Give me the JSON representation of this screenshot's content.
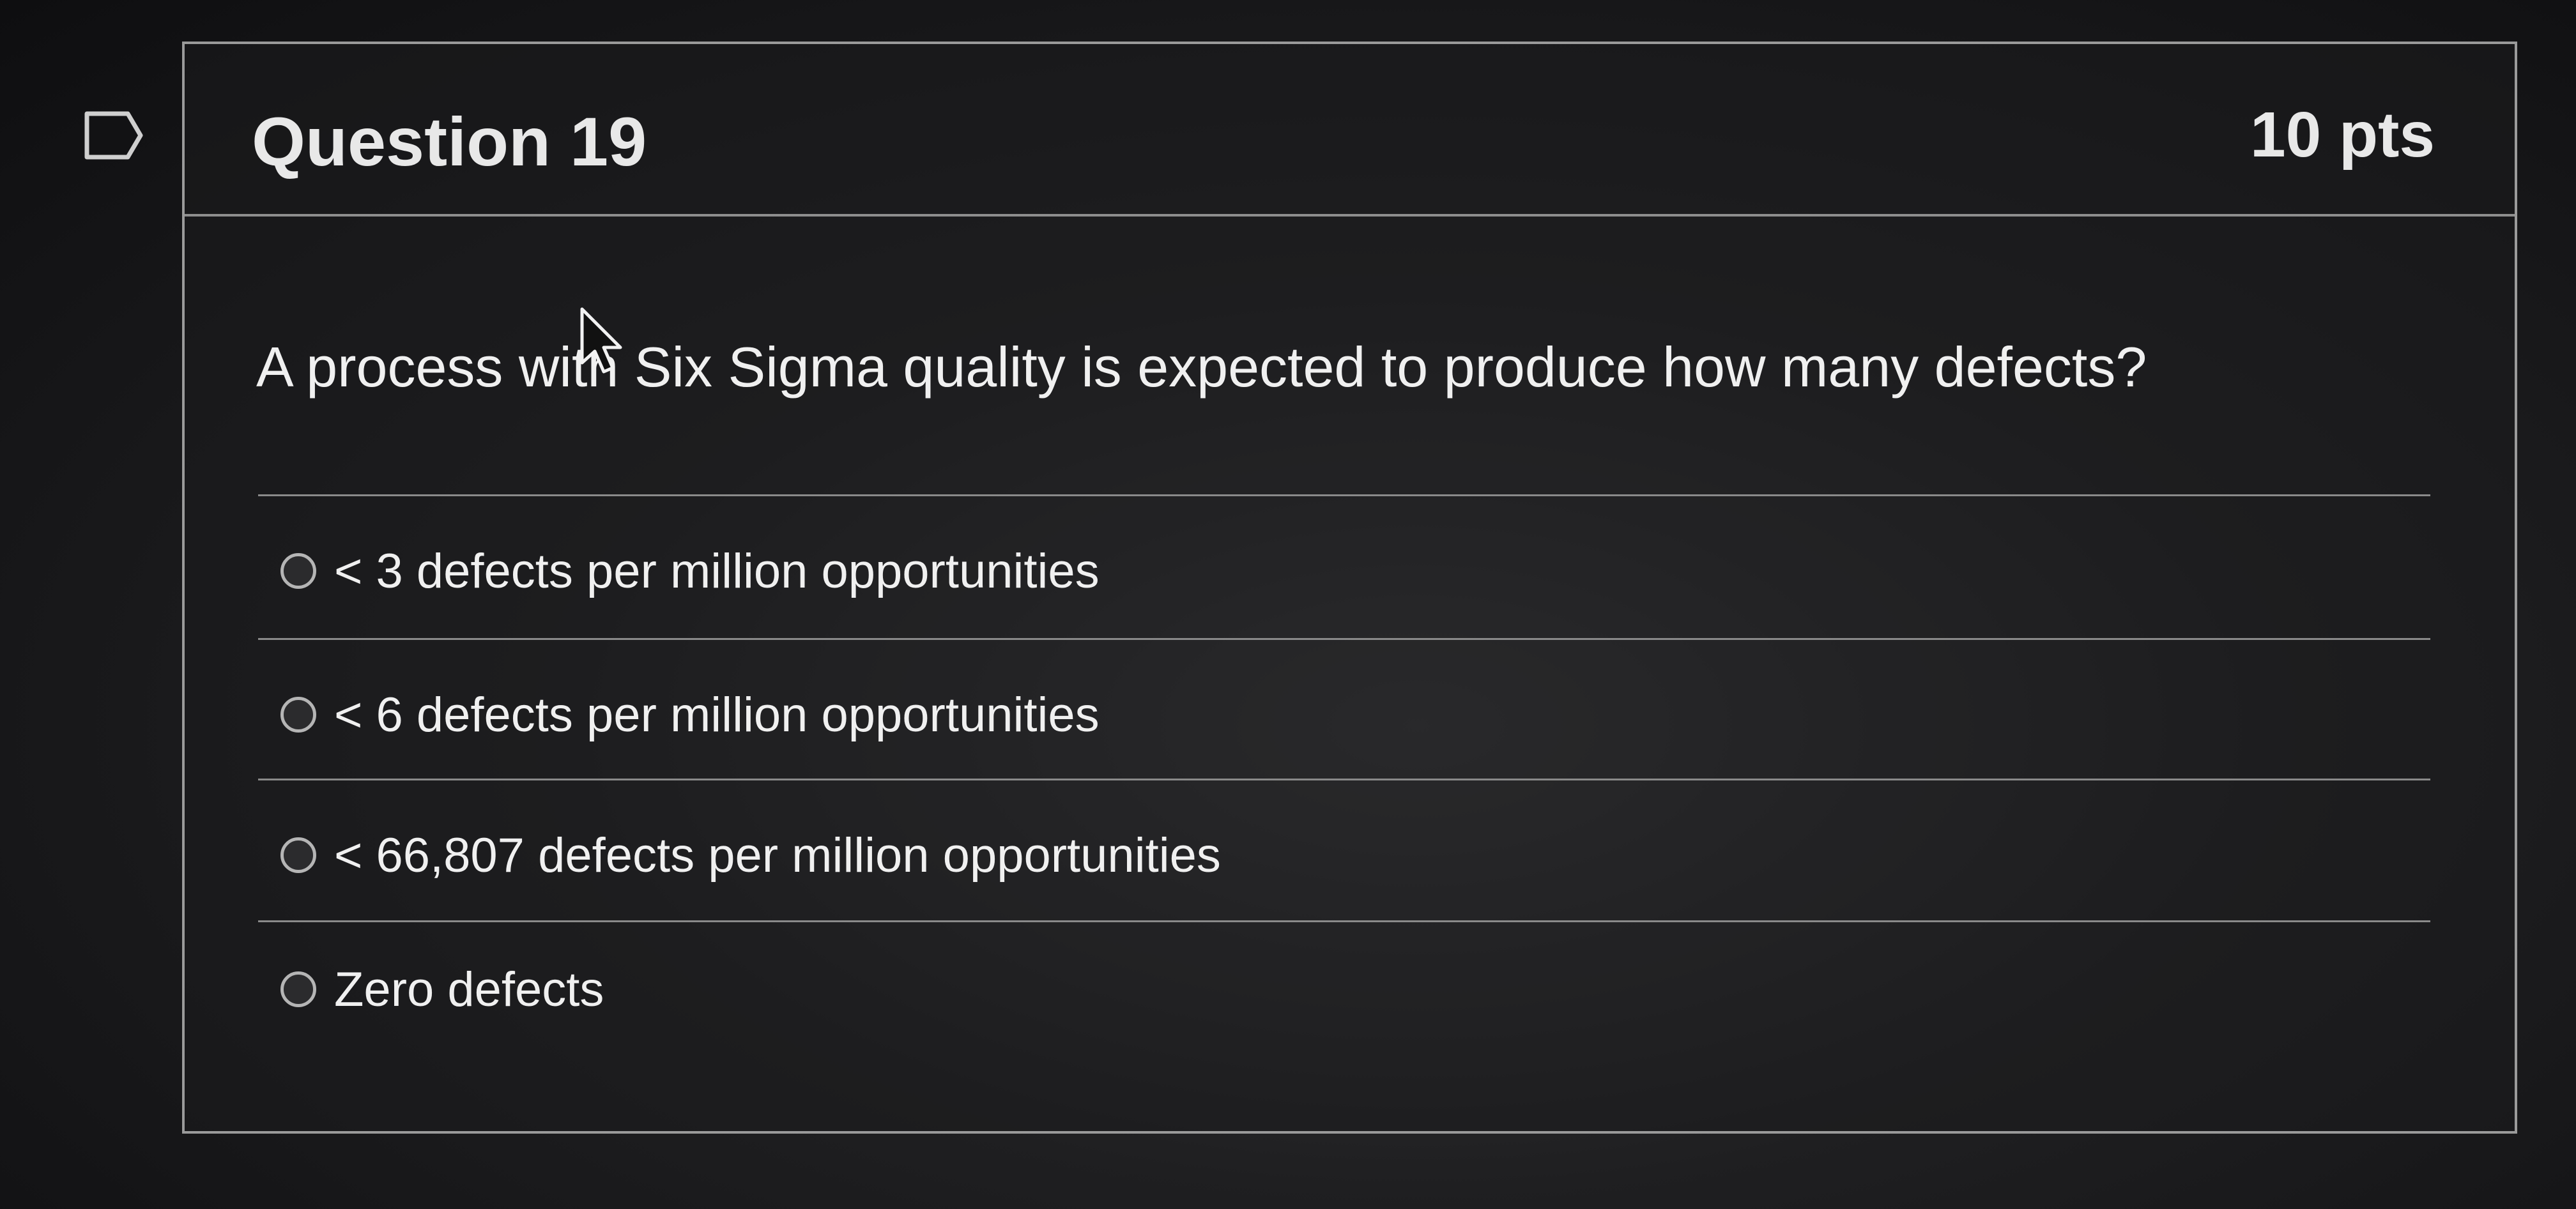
{
  "question": {
    "title": "Question 19",
    "points": "10 pts",
    "text": "A process with Six Sigma quality is expected to produce how many defects?"
  },
  "answers": [
    {
      "label": "< 3 defects per million opportunities",
      "selected": false
    },
    {
      "label": "< 6 defects per million opportunities",
      "selected": false
    },
    {
      "label": "< 66,807 defects per million opportunities",
      "selected": false
    },
    {
      "label": "Zero defects",
      "selected": false
    }
  ],
  "icons": {
    "flag": "flag-icon",
    "cursor": "cursor-arrow-icon"
  },
  "colors": {
    "background": "#1f1f21",
    "text": "#f0f0f0",
    "border": "#9a9a9a"
  }
}
